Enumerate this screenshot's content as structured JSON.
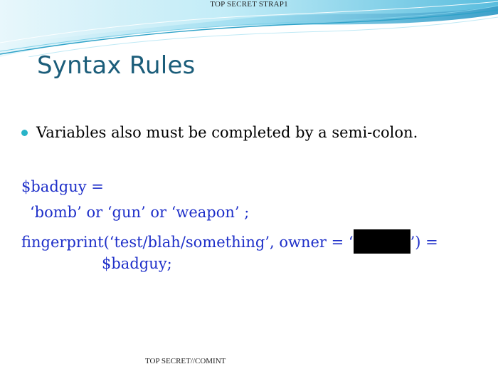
{
  "classification_top": "TOP SECRET STRAP1",
  "classification_bottom": "TOP SECRET//COMINT",
  "title": "Syntax Rules",
  "bullet": "Variables also must be completed by a semi-colon.",
  "code": {
    "line1": "$badguy =",
    "line2": "‘bomb’ or ‘gun’ or ‘weapon’ ;",
    "line3_before": "fingerprint(‘test/blah/something’, owner =  ‘",
    "line3_after": "’) =",
    "line4": "$badguy;"
  },
  "colors": {
    "title": "#1b5d7a",
    "code": "#1e2fc9",
    "bullet": "#28b4c8",
    "wave_light": "#bfe9f5",
    "wave_mid": "#7fd0e8",
    "wave_dark": "#2ea2c8"
  }
}
